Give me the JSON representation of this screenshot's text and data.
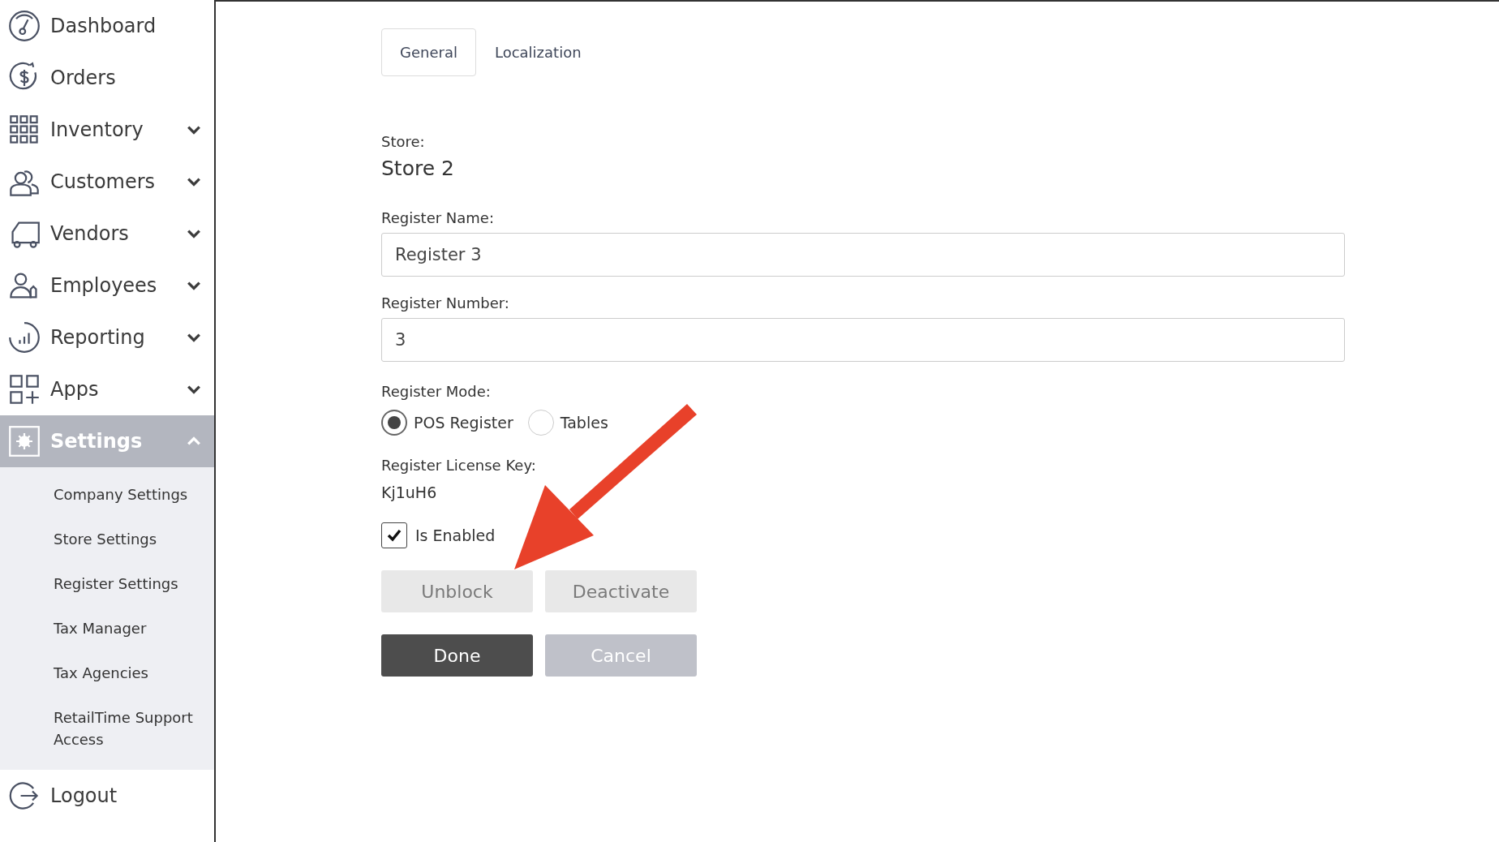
{
  "sidebar": {
    "items": [
      {
        "label": "Dashboard",
        "kind": "link",
        "selected": false
      },
      {
        "label": "Orders",
        "kind": "link",
        "selected": false
      },
      {
        "label": "Inventory",
        "kind": "menu",
        "expanded": false,
        "selected": false
      },
      {
        "label": "Customers",
        "kind": "menu",
        "expanded": false,
        "selected": false
      },
      {
        "label": "Vendors",
        "kind": "menu",
        "expanded": false,
        "selected": false
      },
      {
        "label": "Employees",
        "kind": "menu",
        "expanded": false,
        "selected": false
      },
      {
        "label": "Reporting",
        "kind": "menu",
        "expanded": false,
        "selected": false
      },
      {
        "label": "Apps",
        "kind": "menu",
        "expanded": false,
        "selected": false
      },
      {
        "label": "Settings",
        "kind": "menu",
        "expanded": true,
        "selected": true,
        "children": [
          {
            "label": "Company Settings"
          },
          {
            "label": "Store Settings"
          },
          {
            "label": "Register Settings"
          },
          {
            "label": "Tax Manager"
          },
          {
            "label": "Tax Agencies"
          },
          {
            "label": "RetailTime Support Access"
          }
        ]
      },
      {
        "label": "Logout",
        "kind": "link",
        "selected": false
      }
    ]
  },
  "tabs": [
    {
      "label": "General",
      "selected": true
    },
    {
      "label": "Localization",
      "selected": false
    }
  ],
  "store": {
    "label": "Store:",
    "value": "Store 2"
  },
  "fields": [
    {
      "label": "Register Name:",
      "value": "Register 3"
    },
    {
      "label": "Register Number:",
      "value": "3"
    }
  ],
  "register_mode": {
    "label": "Register Mode:",
    "options": [
      {
        "label": "POS Register",
        "selected": true
      },
      {
        "label": "Tables",
        "selected": false
      }
    ]
  },
  "license": {
    "label": "Register License Key:",
    "value": "Kj1uH6"
  },
  "enabled": {
    "label": "Is Enabled",
    "checked": true
  },
  "buttons": [
    [
      {
        "label": "Unblock",
        "kind": "muted"
      },
      {
        "label": "Deactivate",
        "kind": "muted"
      }
    ],
    [
      {
        "label": "Done",
        "kind": "primary"
      },
      {
        "label": "Cancel",
        "kind": "cancel"
      }
    ]
  ]
}
